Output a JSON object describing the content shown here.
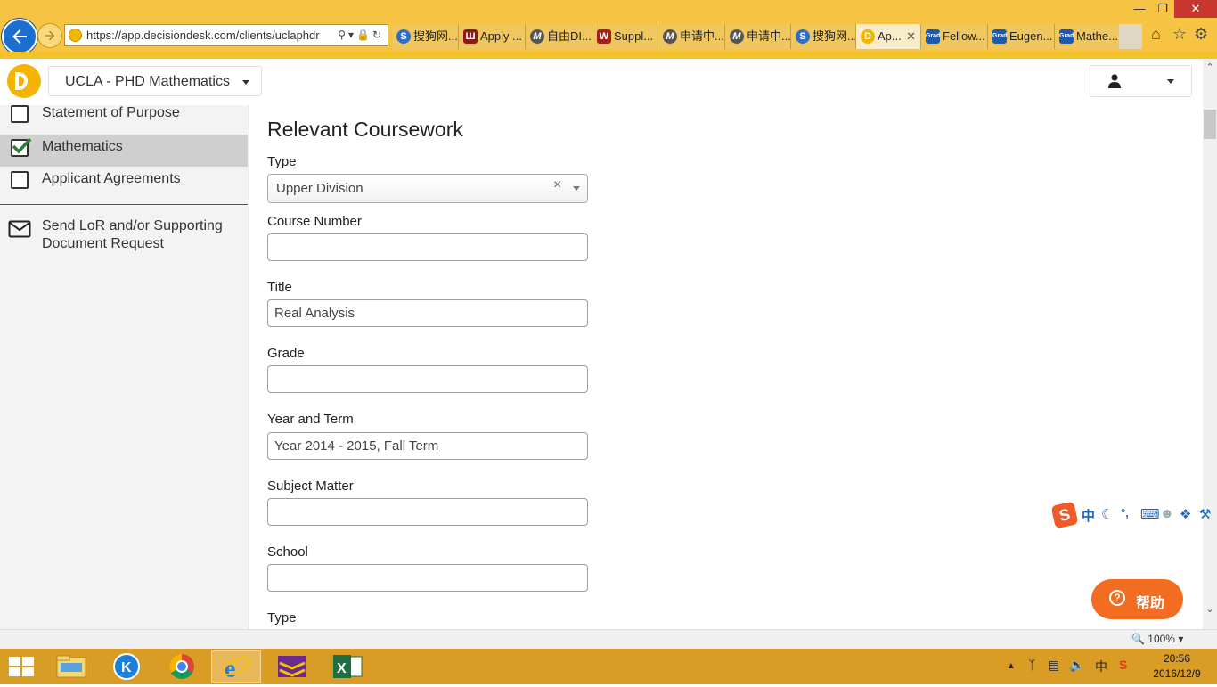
{
  "browser": {
    "url": "https://app.decisiondesk.com/clients/uclaphdr",
    "tabs": [
      {
        "label": "搜狗网...",
        "icon": "sogou-icon",
        "color": "#2d6fc4"
      },
      {
        "label": "Apply ...",
        "icon": "university-icon",
        "color": "#8b1a1a"
      },
      {
        "label": "自由DI...",
        "icon": "m-site-icon",
        "color": "#555555"
      },
      {
        "label": "Suppl...",
        "icon": "w-site-icon",
        "color": "#a31f1f"
      },
      {
        "label": "申请中...",
        "icon": "m-site-icon",
        "color": "#555555"
      },
      {
        "label": "申请中...",
        "icon": "m-site-icon",
        "color": "#555555"
      },
      {
        "label": "搜狗网...",
        "icon": "sogou-icon",
        "color": "#2d6fc4"
      },
      {
        "label": "Ap...",
        "icon": "decisiondesk-icon",
        "color": "#f4b400",
        "active": true
      },
      {
        "label": "Fellow...",
        "icon": "grad-icon",
        "color": "#1f5aa8"
      },
      {
        "label": "Eugen...",
        "icon": "grad-icon",
        "color": "#1f5aa8"
      },
      {
        "label": "Mathe...",
        "icon": "grad-icon",
        "color": "#1f5aa8"
      }
    ],
    "tab_close": "✕",
    "zoom": "100%"
  },
  "header": {
    "program": "UCLA - PHD Mathematics"
  },
  "sidebar": {
    "items": [
      {
        "label": "Statement of Purpose",
        "checked": false
      },
      {
        "label": "Mathematics",
        "checked": true
      },
      {
        "label": "Applicant Agreements",
        "checked": false
      }
    ],
    "send_request": "Send LoR and/or Supporting Document Request"
  },
  "form": {
    "title": "Relevant Coursework",
    "type_label": "Type",
    "type_value": "Upper Division",
    "clear_symbol": "×",
    "course_number_label": "Course Number",
    "course_number_value": "",
    "title_label": "Title",
    "title_value": "Real Analysis",
    "grade_label": "Grade",
    "grade_value": "",
    "year_term_label": "Year and Term",
    "year_term_value": "Year 2014 - 2015, Fall Term",
    "subject_label": "Subject Matter",
    "subject_value": "",
    "school_label": "School",
    "school_value": "",
    "type2_label": "Type"
  },
  "ime": {
    "logo": "S",
    "mode": "中",
    "punct": "°,"
  },
  "help": {
    "symbol": "?",
    "label": "帮助"
  },
  "taskbar": {
    "ime_lang": "中",
    "time": "20:56",
    "date": "2016/12/9"
  },
  "colors": {
    "accent": "#f4b400",
    "browser_bar": "#f6c442",
    "help_orange": "#f26d21",
    "check_green": "#2e7d32",
    "taskbar": "#d99d26"
  }
}
